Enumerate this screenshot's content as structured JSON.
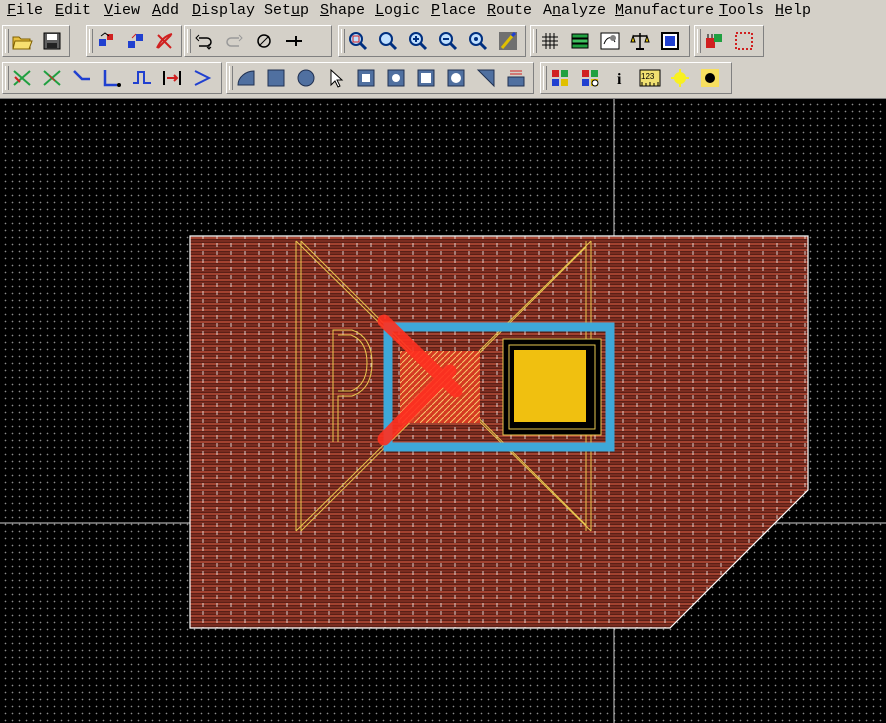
{
  "menu": [
    {
      "pre": "",
      "mn": "F",
      "post": "ile"
    },
    {
      "pre": "",
      "mn": "E",
      "post": "dit"
    },
    {
      "pre": "",
      "mn": "V",
      "post": "iew"
    },
    {
      "pre": "",
      "mn": "A",
      "post": "dd"
    },
    {
      "pre": "",
      "mn": "D",
      "post": "isplay"
    },
    {
      "pre": "Set",
      "mn": "u",
      "post": "p"
    },
    {
      "pre": "",
      "mn": "S",
      "post": "hape"
    },
    {
      "pre": "",
      "mn": "L",
      "post": "ogic"
    },
    {
      "pre": "",
      "mn": "P",
      "post": "lace"
    },
    {
      "pre": "",
      "mn": "R",
      "post": "oute"
    },
    {
      "pre": "A",
      "mn": "n",
      "post": "alyze"
    },
    {
      "pre": "",
      "mn": "M",
      "post": "anufacture"
    },
    {
      "pre": "",
      "mn": "T",
      "post": "ools"
    },
    {
      "pre": "",
      "mn": "H",
      "post": "elp"
    }
  ],
  "toolbar_row1": [
    {
      "icon": "open-folder-icon"
    },
    {
      "icon": "save-icon"
    },
    {
      "icon": "move-icon"
    },
    {
      "icon": "copy-icon"
    },
    {
      "icon": "delete-icon"
    },
    {
      "icon": "undo-icon"
    },
    {
      "icon": "redo-icon"
    },
    {
      "icon": "unrats-icon"
    },
    {
      "icon": "pin-icon"
    },
    {
      "icon": "zoom-points-icon"
    },
    {
      "icon": "zoom-fit-icon"
    },
    {
      "icon": "zoom-in-icon"
    },
    {
      "icon": "zoom-out-icon"
    },
    {
      "icon": "zoom-world-icon"
    },
    {
      "icon": "redraw-icon"
    },
    {
      "icon": "grid-icon"
    },
    {
      "icon": "layers-icon"
    },
    {
      "icon": "shadow-icon"
    },
    {
      "icon": "balance-icon"
    },
    {
      "icon": "display-frame-icon"
    },
    {
      "icon": "component-icon"
    },
    {
      "icon": "spinning-icon"
    }
  ],
  "toolbar_row2": [
    {
      "icon": "add-connect-icon"
    },
    {
      "icon": "slide-icon"
    },
    {
      "icon": "route-diagonal-icon"
    },
    {
      "icon": "route-ortho-icon"
    },
    {
      "icon": "route-step-icon"
    },
    {
      "icon": "fanout-icon"
    },
    {
      "icon": "delay-tune-icon"
    },
    {
      "icon": "shape-arc-icon"
    },
    {
      "icon": "shape-rect-icon"
    },
    {
      "icon": "shape-circle-icon"
    },
    {
      "icon": "select-pointer-icon"
    },
    {
      "icon": "shape-select-icon"
    },
    {
      "icon": "shape-merge-icon"
    },
    {
      "icon": "shape-void-icon"
    },
    {
      "icon": "shape-void-circle-icon"
    },
    {
      "icon": "shape-edit-icon"
    },
    {
      "icon": "shape-fill-icon"
    },
    {
      "icon": "color-icon"
    },
    {
      "icon": "color-visible-icon"
    },
    {
      "icon": "info-icon"
    },
    {
      "icon": "measure-icon"
    },
    {
      "icon": "highlight-icon"
    },
    {
      "icon": "dehighlight-icon"
    }
  ],
  "canvas": {
    "background": "#000000",
    "grid_color": "#8a8a8a",
    "outline_color": "#ffffff",
    "copper_hatch_color": "#b84a36",
    "silk_color": "#e8d060",
    "pad_color": "#f0c010",
    "mask_color": "#3ea8d8",
    "red_color": "#ff3020"
  }
}
